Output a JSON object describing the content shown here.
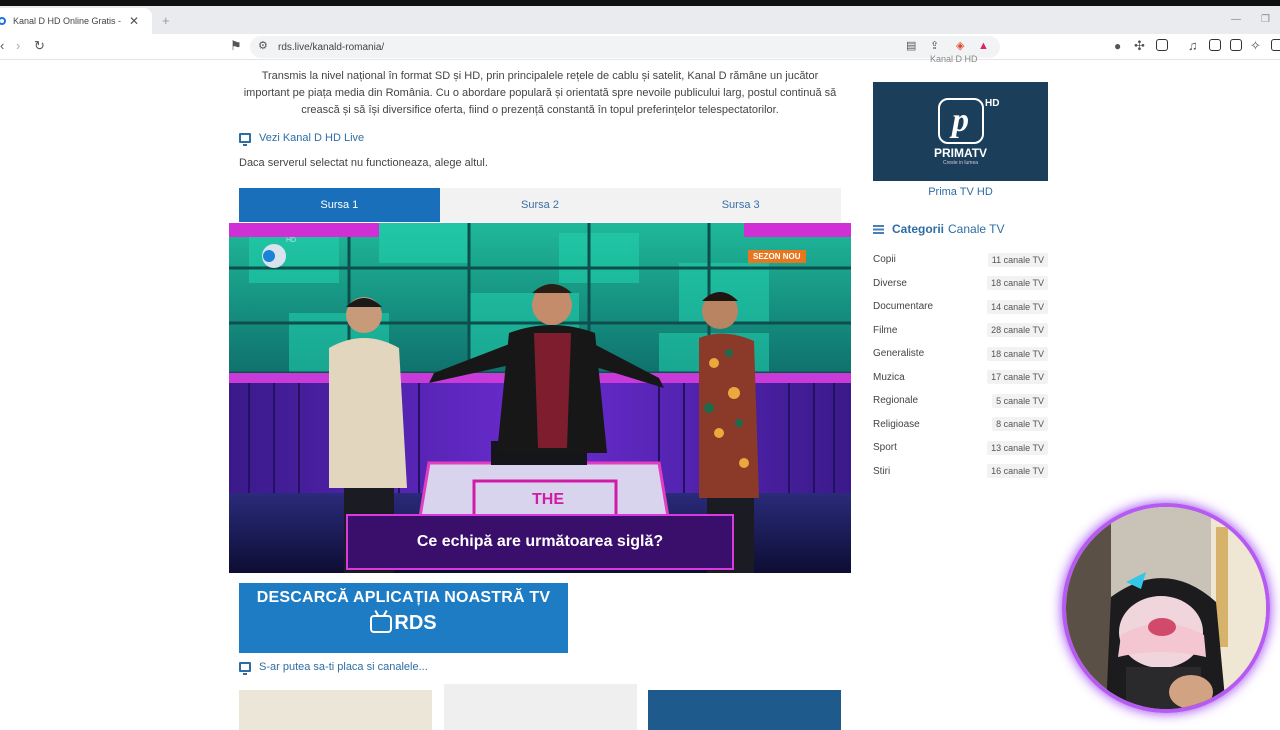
{
  "browser": {
    "tab_title": "Kanal D HD Online Gratis - RDS.live",
    "new_tab": "+",
    "url": "rds.live/kanald-romania/"
  },
  "article": {
    "intro": "Transmis la nivel național în format SD și HD, prin principalele rețele de cablu și satelit, Kanal D rămâne un jucător important pe piața media din România. Cu o abordare populară și orientată spre nevoile publicului larg, postul continuă să crească și să își diversifice oferta, fiind o prezență constantă în topul preferințelor telespectatorilor.",
    "watch_link": "Vezi Kanal D HD Live",
    "server_note": "Daca serverul selectat nu functioneaza, alege altul.",
    "sources": [
      "Sursa 1",
      "Sursa 2",
      "Sursa 3"
    ],
    "active_source": "Sursa 1"
  },
  "player": {
    "channel_badge": "HD",
    "season_badge": "SEZON NOU",
    "show_sign": "THE",
    "question": "Ce echipă are următoarea siglă?"
  },
  "app_banner": {
    "headline": "DESCARCĂ APLICAȚIA NOASTRĂ TV",
    "logo_text": "RDS"
  },
  "fix_link": "S-ar putea sa-ti placa si canalele...",
  "sidebar": {
    "previous_caption": "Kanal D HD",
    "featured": {
      "logo_letter": "p",
      "logo_hd": "HD",
      "logo_name": "PRIMATV",
      "logo_tagline": "Creste in lumea",
      "title": "Prima TV HD"
    },
    "categories_heading_bold": "Categorii",
    "categories_heading_rest": "Canale TV",
    "categories": [
      {
        "name": "Copii",
        "count": "11 canale TV"
      },
      {
        "name": "Diverse",
        "count": "18 canale TV"
      },
      {
        "name": "Documentare",
        "count": "14 canale TV"
      },
      {
        "name": "Filme",
        "count": "28 canale TV"
      },
      {
        "name": "Generaliste",
        "count": "18 canale TV"
      },
      {
        "name": "Muzica",
        "count": "17 canale TV"
      },
      {
        "name": "Regionale",
        "count": "5 canale TV"
      },
      {
        "name": "Religioase",
        "count": "8 canale TV"
      },
      {
        "name": "Sport",
        "count": "13 canale TV"
      },
      {
        "name": "Stiri",
        "count": "16 canale TV"
      }
    ]
  },
  "colors": {
    "accent_blue": "#1a6fba",
    "link_blue": "#2e6da4",
    "badge_orange": "#e8761f",
    "webcam_ring": "#b65bf2"
  }
}
